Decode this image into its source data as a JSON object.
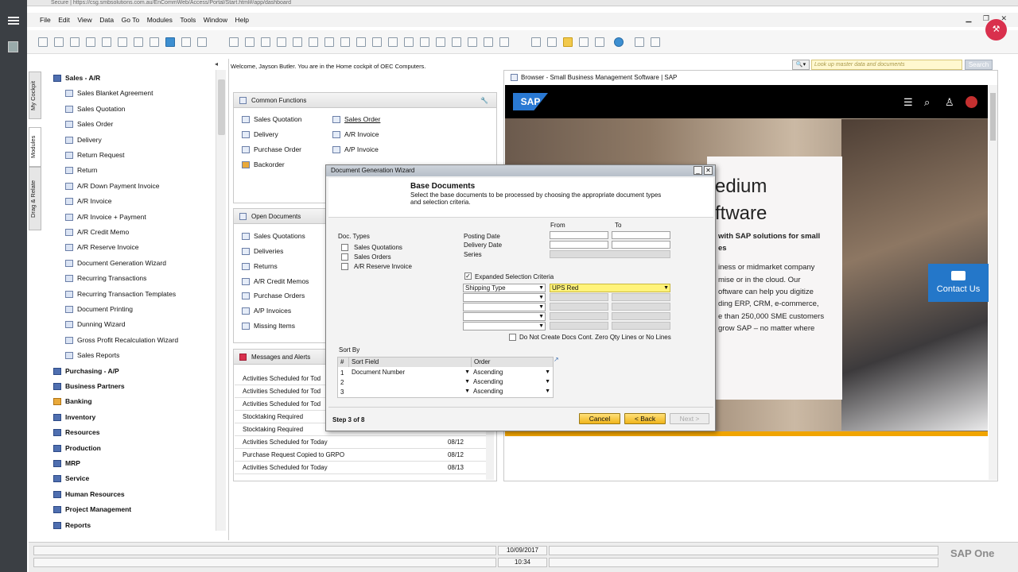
{
  "browser": {
    "address": "Secure | https://csg.smbsolutions.com.au/EnCommWeb/Access/Portal/Start.html#/app/dashboard"
  },
  "menu": [
    "File",
    "Edit",
    "View",
    "Data",
    "Go To",
    "Modules",
    "Tools",
    "Window",
    "Help"
  ],
  "vtabs": [
    "My Cockpit",
    "Modules",
    "Drag & Relate"
  ],
  "sidebar": {
    "header": "Sales - A/R",
    "items": [
      "Sales Blanket Agreement",
      "Sales Quotation",
      "Sales Order",
      "Delivery",
      "Return Request",
      "Return",
      "A/R Down Payment Invoice",
      "A/R Invoice",
      "A/R Invoice + Payment",
      "A/R Credit Memo",
      "A/R Reserve Invoice",
      "Document Generation Wizard",
      "Recurring Transactions",
      "Recurring Transaction Templates",
      "Document Printing",
      "Dunning Wizard",
      "Gross Profit Recalculation Wizard",
      "Sales Reports"
    ],
    "modules": [
      "Purchasing - A/P",
      "Business Partners",
      "Banking",
      "Inventory",
      "Resources",
      "Production",
      "MRP",
      "Service",
      "Human Resources",
      "Project Management",
      "Reports"
    ]
  },
  "welcome": "Welcome, Jayson Butler. You are in the Home cockpit of OEC Computers.",
  "common": {
    "title": "Common Functions",
    "col1": [
      "Sales Quotation",
      "Delivery",
      "Purchase Order",
      "Backorder"
    ],
    "col2": [
      "Sales Order",
      "A/R Invoice",
      "A/P Invoice"
    ]
  },
  "open": {
    "title": "Open Documents",
    "items": [
      "Sales Quotations",
      "Deliveries",
      "Returns",
      "A/R Credit Memos",
      "Purchase Orders",
      "A/P Invoices",
      "Missing Items"
    ]
  },
  "messages": {
    "title": "Messages and Alerts",
    "rows": [
      {
        "t": "Activities Scheduled for Tod",
        "d": ""
      },
      {
        "t": "Activities Scheduled for Tod",
        "d": ""
      },
      {
        "t": "Activities Scheduled for Tod",
        "d": ""
      },
      {
        "t": "Stocktaking Required",
        "d": ""
      },
      {
        "t": "Stocktaking Required",
        "d": ""
      },
      {
        "t": "Activities Scheduled for Today",
        "d": "08/12"
      },
      {
        "t": "Purchase Request Copied to GRPO",
        "d": "08/12"
      },
      {
        "t": "Activities Scheduled for Today",
        "d": "08/13"
      }
    ]
  },
  "search": {
    "placeholder": "Look up master data and documents",
    "button": "Search"
  },
  "browserpane": {
    "title": "Browser - Small Business Management Software | SAP",
    "logo": "SAP",
    "line1": "edium",
    "line2": "ftware",
    "p1": "with SAP solutions for small",
    "p1b": "es",
    "lines": [
      "iness or midmarket company",
      "mise or in the cloud. Our",
      "oftware can help you digitize",
      "ding ERP, CRM, e-commerce,",
      "e than 250,000 SME customers",
      "grow SAP – no matter where"
    ],
    "contact": "Contact Us"
  },
  "dialog": {
    "title": "Document Generation Wizard",
    "heading": "Base Documents",
    "desc1": "Select the base documents to be processed by choosing the appropriate document types",
    "desc2": "and selection criteria.",
    "from": "From",
    "to": "To",
    "doctypes": "Doc. Types",
    "types": [
      "Sales Quotations",
      "Sales Orders",
      "A/R Reserve Invoice"
    ],
    "posting": "Posting Date",
    "delivery": "Delivery Date",
    "series": "Series",
    "expanded": "Expanded Selection Criteria",
    "crit_field": "Shipping Type",
    "crit_value": "UPS Red",
    "noZero": "Do Not Create Docs Cont. Zero Qty Lines or No Lines",
    "sortby": "Sort By",
    "sort_cols": [
      "#",
      "Sort Field",
      "Order"
    ],
    "sort_rows": [
      {
        "n": "1",
        "f": "Document Number",
        "o": "Ascending"
      },
      {
        "n": "2",
        "f": "",
        "o": "Ascending"
      },
      {
        "n": "3",
        "f": "",
        "o": "Ascending"
      }
    ],
    "step": "Step 3 of 8",
    "cancel": "Cancel",
    "back": "< Back",
    "next": "Next >"
  },
  "status": {
    "date": "10/09/2017",
    "time": "10:34",
    "brand": "SAP One"
  }
}
